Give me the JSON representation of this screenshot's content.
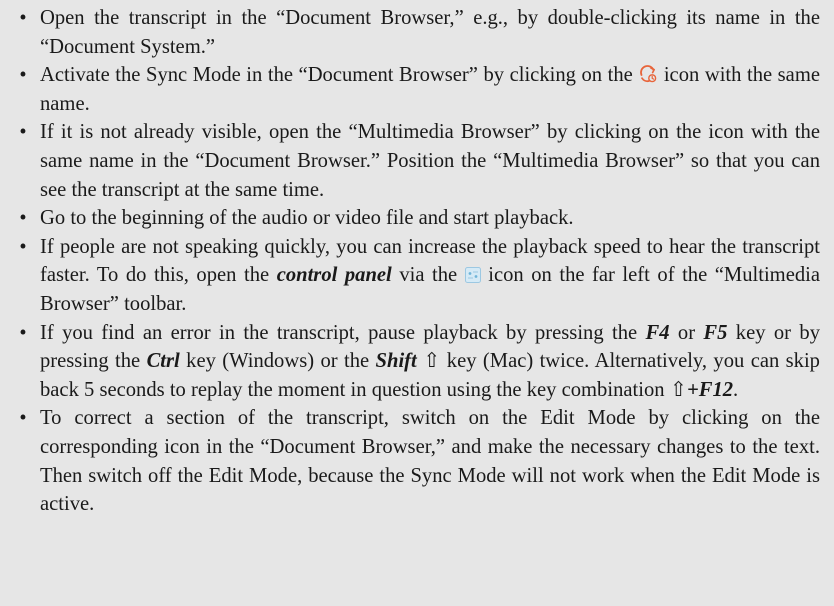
{
  "bullet_glyph": "•",
  "items": [
    {
      "text": "Open the transcript in the “Document Browser,” e.g., by double-clicking its name in the “Document System.”"
    },
    {
      "before": "Activate the Sync Mode in the “Document Browser” by clicking on the ",
      "icon": "sync-mode-icon",
      "after": " icon with the same name."
    },
    {
      "text": "If it is not already visible, open the “Multimedia Browser” by clicking on the icon with the same name in the “Document Browser.” Position the “Multimedia Browser” so that you can see the transcript at the same time."
    },
    {
      "text": "Go to the beginning of the audio or video file and start playback."
    },
    {
      "before": "If people are not speaking quickly, you can increase the playback speed to hear the transcript faster. To do this, open the ",
      "emph": "control panel",
      "middle": " via the ",
      "icon": "control-panel-icon",
      "after": " icon on the far left of the “Multimedia Browser” toolbar."
    },
    {
      "p1": "If you find an error in the transcript, pause playback by pressing the ",
      "k1": "F4",
      "p2": " or ",
      "k2": "F5",
      "p3": " key or by pressing the ",
      "k3": "Ctrl",
      "p4": " key (Windows) or the ",
      "k4": "Shift",
      "p5": " ⇧ key (Mac) twice. Alternatively, you can skip back 5 seconds to replay the moment in question using the key combination ⇧",
      "k5": "+F12",
      "p6": "."
    },
    {
      "text": "To correct a section of the transcript, switch on the Edit Mode by clicking on the corresponding icon in the “Document Browser,” and make the necessary changes to the text. Then switch off the Edit Mode, because the Sync Mode will not work when the Edit Mode is active."
    }
  ],
  "colors": {
    "background": "#e6e6e6",
    "text": "#1a1a1a",
    "sync_icon": "#e8643a",
    "control_icon": "#6fb4d8"
  }
}
